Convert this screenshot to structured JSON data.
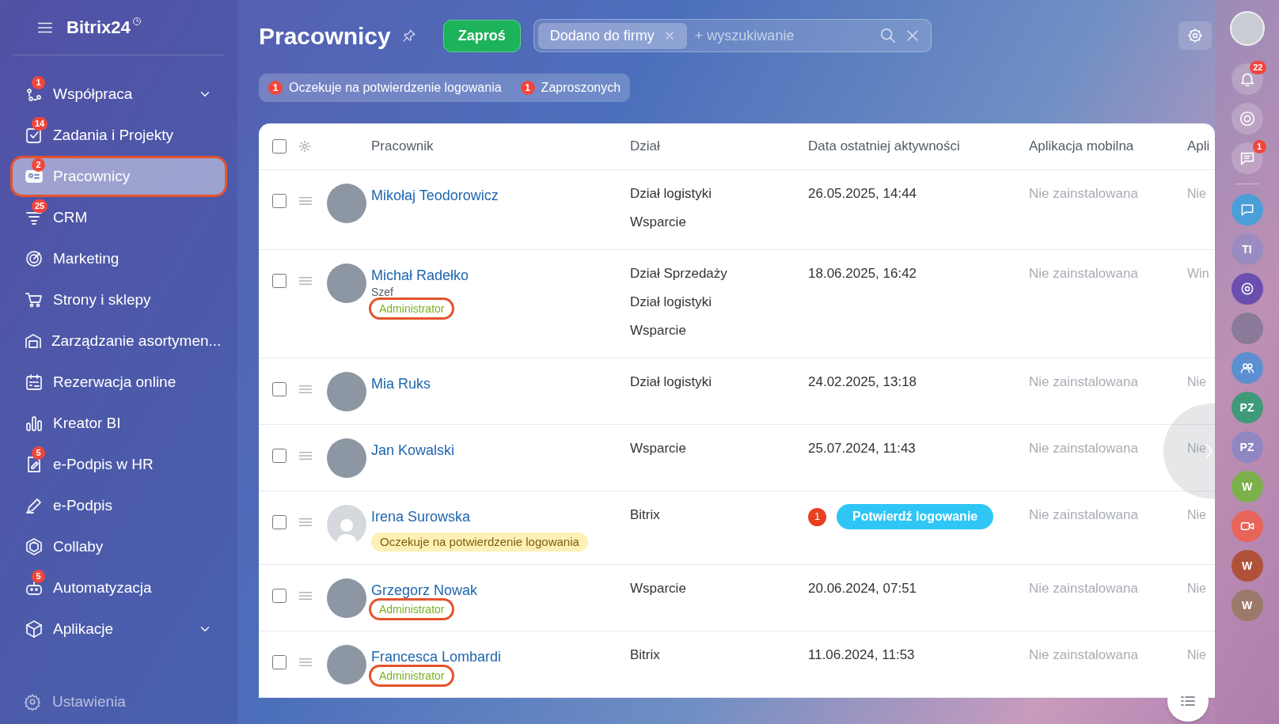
{
  "sidebar": {
    "logo": "Bitrix24",
    "items": [
      {
        "label": "Współpraca",
        "badge": "1",
        "expandable": true,
        "selected": false,
        "highlighted": false
      },
      {
        "label": "Zadania i Projekty",
        "badge": "14",
        "expandable": false,
        "selected": false,
        "highlighted": false
      },
      {
        "label": "Pracownicy",
        "badge": "2",
        "expandable": false,
        "selected": true,
        "highlighted": true
      },
      {
        "label": "CRM",
        "badge": "25",
        "expandable": false,
        "selected": false,
        "highlighted": false
      },
      {
        "label": "Marketing",
        "expandable": false,
        "selected": false,
        "highlighted": false
      },
      {
        "label": "Strony i sklepy",
        "expandable": false,
        "selected": false,
        "highlighted": false
      },
      {
        "label": "Zarządzanie asortymen...",
        "expandable": false,
        "selected": false,
        "highlighted": false
      },
      {
        "label": "Rezerwacja online",
        "expandable": false,
        "selected": false,
        "highlighted": false
      },
      {
        "label": "Kreator BI",
        "expandable": false,
        "selected": false,
        "highlighted": false
      },
      {
        "label": "e-Podpis w HR",
        "badge": "5",
        "expandable": false,
        "selected": false,
        "highlighted": false
      },
      {
        "label": "e-Podpis",
        "expandable": false,
        "selected": false,
        "highlighted": false
      },
      {
        "label": "Collaby",
        "expandable": false,
        "selected": false,
        "highlighted": false
      },
      {
        "label": "Automatyzacja",
        "badge": "5",
        "expandable": false,
        "selected": false,
        "highlighted": false
      },
      {
        "label": "Aplikacje",
        "expandable": true,
        "selected": false,
        "highlighted": false
      }
    ],
    "settings": "Ustawienia"
  },
  "header": {
    "title": "Pracownicy",
    "invite_button": "Zaproś",
    "filter_chip": "Dodano do firmy",
    "search_placeholder": "+ wyszukiwanie"
  },
  "quick_filters": [
    {
      "count": "1",
      "label": "Oczekuje na potwierdzenie logowania"
    },
    {
      "count": "1",
      "label": "Zaproszonych"
    }
  ],
  "table": {
    "select_all_checked": false,
    "columns": [
      "Pracownik",
      "Dział",
      "Data ostatniej aktywności",
      "Aplikacja mobilna",
      "Apli"
    ],
    "rows": [
      {
        "kind": "photo",
        "checked": false,
        "name": "Mikołaj Teodorowicz",
        "departments": [
          "Dział logistyki",
          "Wsparcie"
        ],
        "activity": {
          "kind": "date",
          "text": "26.05.2025, 14:44"
        },
        "mobile_app": "Nie zainstalowana",
        "column_5": "Nie"
      },
      {
        "kind": "photo",
        "checked": false,
        "name": "Michał Radełko",
        "position": "Szef",
        "role": {
          "text": "Administrator",
          "highlighted": true
        },
        "departments": [
          "Dział Sprzedaży",
          "Dział logistyki",
          "Wsparcie"
        ],
        "activity": {
          "kind": "date",
          "text": "18.06.2025, 16:42"
        },
        "mobile_app": "Nie zainstalowana",
        "column_5": "Win"
      },
      {
        "kind": "photo",
        "checked": false,
        "name": "Mia Ruks",
        "departments": [
          "Dział logistyki"
        ],
        "activity": {
          "kind": "date",
          "text": "24.02.2025, 13:18"
        },
        "mobile_app": "Nie zainstalowana",
        "column_5": "Nie"
      },
      {
        "kind": "photo",
        "checked": false,
        "name": "Jan Kowalski",
        "departments": [
          "Wsparcie"
        ],
        "activity": {
          "kind": "date",
          "text": "25.07.2024, 11:43"
        },
        "mobile_app": "Nie zainstalowana",
        "column_5": "Nie"
      },
      {
        "kind": "placeholder",
        "checked": false,
        "name": "Irena Surowska",
        "status": "Oczekuje na potwierdzenie logowania",
        "departments": [
          "Bitrix"
        ],
        "activity": {
          "kind": "confirm",
          "counter": "1",
          "button": "Potwierdź logowanie"
        },
        "mobile_app": "Nie zainstalowana",
        "column_5": "Nie"
      },
      {
        "kind": "photo",
        "checked": false,
        "name": "Grzegorz Nowak",
        "role": {
          "text": "Administrator",
          "highlighted": true
        },
        "departments": [
          "Wsparcie"
        ],
        "activity": {
          "kind": "date",
          "text": "20.06.2024, 07:51"
        },
        "mobile_app": "Nie zainstalowana",
        "column_5": "Nie"
      },
      {
        "kind": "photo",
        "checked": false,
        "name": "Francesca Lombardi",
        "role": {
          "text": "Administrator",
          "highlighted": true
        },
        "departments": [
          "Bitrix"
        ],
        "activity": {
          "kind": "date",
          "text": "11.06.2024, 11:53"
        },
        "mobile_app": "Nie zainstalowana",
        "column_5": "Nie"
      }
    ]
  },
  "right_rail": {
    "notifications_badge": "22",
    "chat_badge": "1",
    "chats": [
      {
        "kind": "chat",
        "color": "#4a9fd8"
      },
      {
        "kind": "initials",
        "text": "TI",
        "color": "#9a8cc0"
      },
      {
        "kind": "target",
        "color": "#6a4fb0"
      },
      {
        "kind": "photo",
        "color": "#8a7a9a"
      },
      {
        "kind": "group",
        "color": "#5b8fd0"
      },
      {
        "kind": "initials",
        "text": "PZ",
        "color": "#3f9a7a"
      },
      {
        "kind": "initials",
        "text": "PZ",
        "color": "#8f86c2"
      },
      {
        "kind": "initials",
        "text": "W",
        "color": "#7bb04a"
      },
      {
        "kind": "video",
        "color": "#e8645a"
      },
      {
        "kind": "initials",
        "text": "W",
        "color": "#b0523a"
      },
      {
        "kind": "initials",
        "text": "W",
        "color": "#9a7a6a"
      }
    ]
  }
}
